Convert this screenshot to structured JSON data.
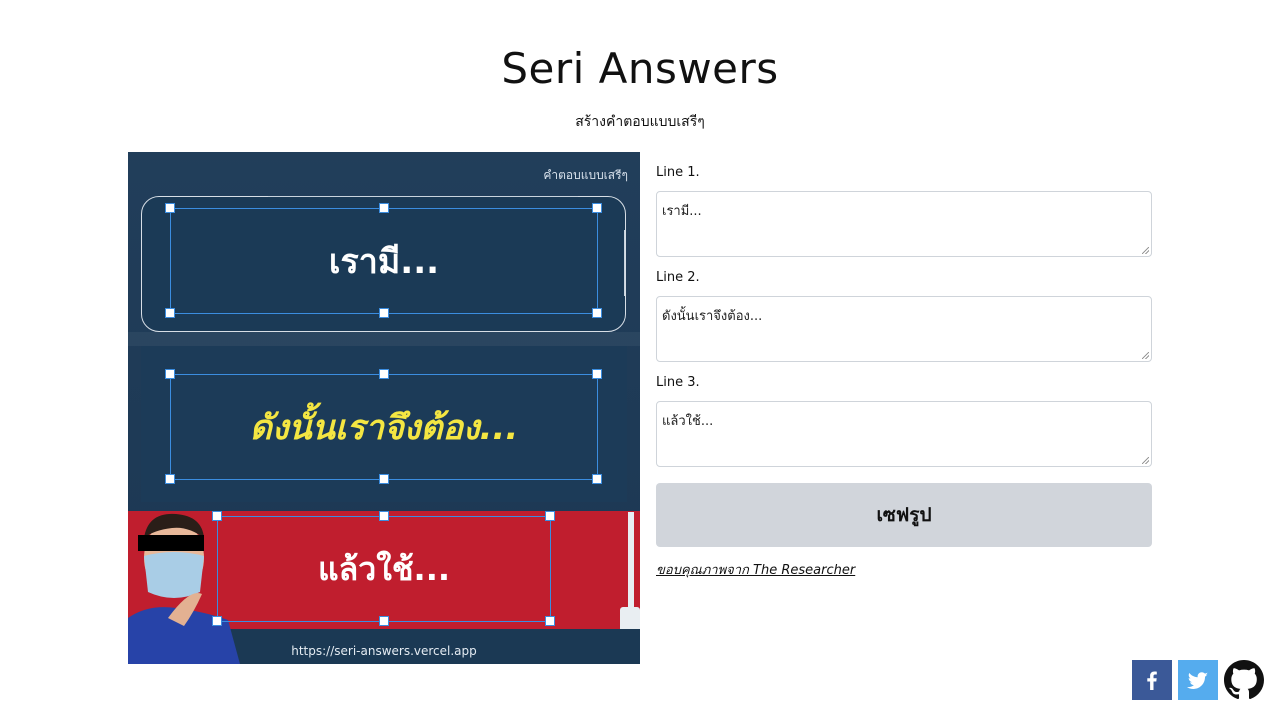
{
  "header": {
    "title": "Seri Answers",
    "subtitle": "สร้างคำตอบแบบเสรีๆ"
  },
  "canvas": {
    "corner_text": "คำตอบแบบเสรีๆ",
    "line1": "เรามี...",
    "line2": "ดังนั้นเราจึงต้อง...",
    "line3": "แล้วใช้...",
    "url": "https://seri-answers.vercel.app",
    "colors": {
      "background": "#1d3a57",
      "line2_text": "#f4e642",
      "red_panel": "#c01e2e",
      "selection": "#3b8de0"
    }
  },
  "form": {
    "fields": [
      {
        "label": "Line 1.",
        "value": "เรามี..."
      },
      {
        "label": "Line 2.",
        "value": "ดังนั้นเราจึงต้อง..."
      },
      {
        "label": "Line 3.",
        "value": "แล้วใช้..."
      }
    ],
    "save_label": "เซฟรูป",
    "credit_text": "ขอบคุณภาพจาก The Researcher"
  },
  "social": {
    "facebook_icon": "facebook-icon",
    "twitter_icon": "twitter-icon",
    "github_icon": "github-icon",
    "facebook_color": "#3b5998",
    "twitter_color": "#55acee"
  }
}
